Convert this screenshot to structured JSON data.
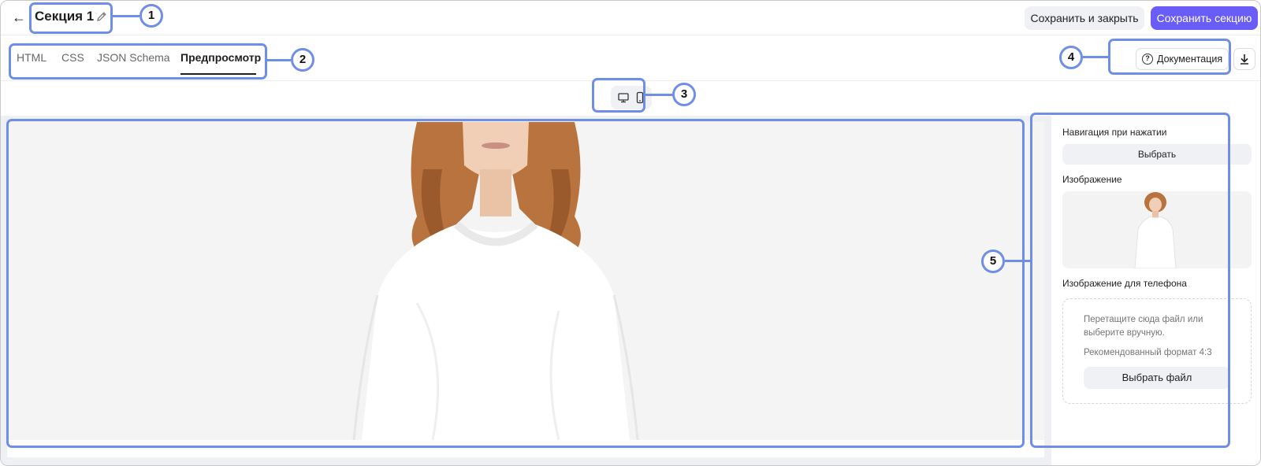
{
  "header": {
    "title": "Секция 1",
    "save_close_label": "Сохранить и закрыть",
    "save_label": "Сохранить секцию"
  },
  "tabs": [
    {
      "label": "HTML"
    },
    {
      "label": "CSS"
    },
    {
      "label": "JSON Schema"
    },
    {
      "label": "Предпросмотр",
      "active": true
    }
  ],
  "toolbar": {
    "docs_label": "Документация"
  },
  "panel": {
    "nav_label": "Навигация при нажатии",
    "choose_label": "Выбрать",
    "image_label": "Изображение",
    "phone_image_label": "Изображение для телефона",
    "drop_text": "Перетащите сюда файл или выберите вручную.",
    "format_hint": "Рекомендованный формат 4:3",
    "choose_file_label": "Выбрать файл"
  },
  "callouts": [
    "1",
    "2",
    "3",
    "4",
    "5"
  ],
  "colors": {
    "accent": "#6a5cf6",
    "highlight": "#6f8fe6"
  }
}
